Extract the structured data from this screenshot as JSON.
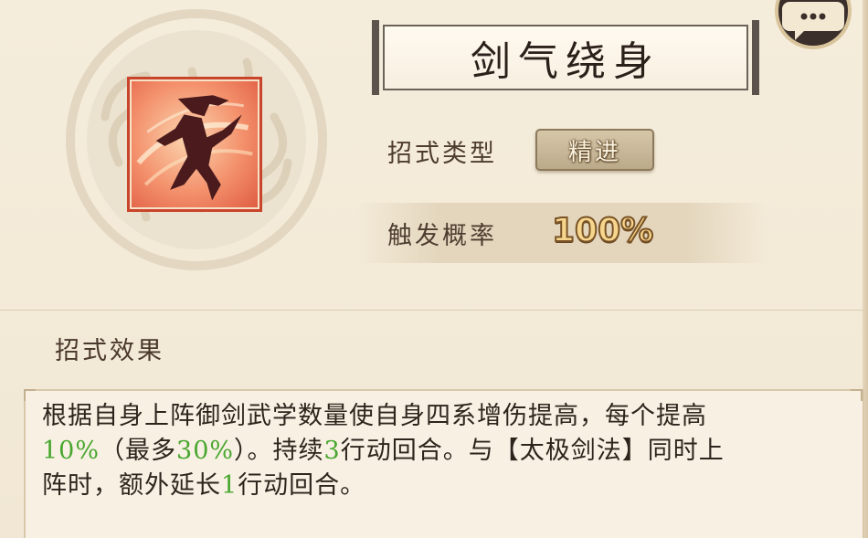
{
  "skill": {
    "name": "剑气绕身",
    "type_label": "招式类型",
    "type_value": "精进",
    "rate_label": "触发概率",
    "rate_value": "100%"
  },
  "effect": {
    "section_title": "招式效果",
    "line1": "根据自身上阵御剑武学数量使自身四系增伤提高，每个提高",
    "line2_a": "10%",
    "line2_b": "（最多",
    "line2_c": "30%",
    "line2_d": "）。持续",
    "line2_e": "3",
    "line2_f": "行动回合。与【太极剑法】同时上",
    "line3_a": "阵时，额外延长",
    "line3_b": "1",
    "line3_c": "行动回合。"
  },
  "icons": {
    "skill_icon": "sword-qi-figure-icon",
    "chat": "chat-bubble-icon",
    "emblem": "cloud-emblem-icon"
  },
  "colors": {
    "highlight_green": "#49a62f",
    "rate_gold": "#f6d58c",
    "icon_border": "#c8442b"
  }
}
